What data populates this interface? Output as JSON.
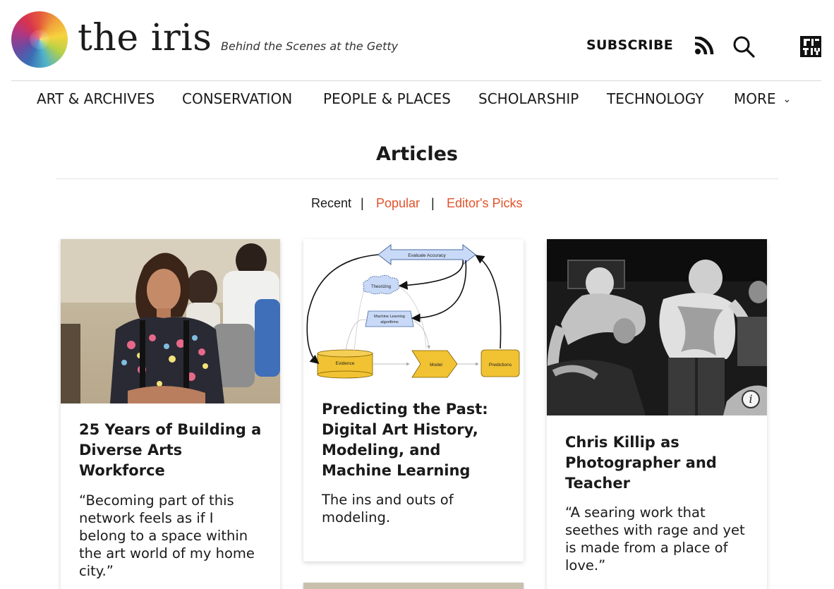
{
  "header": {
    "brand": "the iris",
    "tagline": "Behind the Scenes at the Getty",
    "subscribe_label": "SUBSCRIBE",
    "icons": [
      "rss-icon",
      "search-icon",
      "getty-logo"
    ]
  },
  "nav": {
    "items": [
      {
        "label": "ART & ARCHIVES"
      },
      {
        "label": "CONSERVATION"
      },
      {
        "label": "PEOPLE & PLACES"
      },
      {
        "label": "SCHOLARSHIP"
      },
      {
        "label": "TECHNOLOGY"
      },
      {
        "label": "MORE"
      }
    ]
  },
  "section": {
    "title": "Articles"
  },
  "tabs": {
    "items": [
      {
        "label": "Recent",
        "active": true
      },
      {
        "label": "Popular",
        "active": false
      },
      {
        "label": "Editor's Picks",
        "active": false
      }
    ],
    "separator": "|"
  },
  "colors": {
    "accent_link": "#e2532b",
    "text": "#1a1a1a",
    "diagram_box": "#f1c232",
    "diagram_blue": "#c9daf8"
  },
  "cards": [
    {
      "title": "25 Years of Building a Diverse Arts Workforce",
      "description": "“Becoming part of this network feels as if I belong to a space within the art world of my home city.”",
      "image": "photo-young-woman-seated-group"
    },
    {
      "title": "Predicting the Past: Digital Art History, Modeling, and Machine Learning",
      "description": "The ins and outs of modeling.",
      "image": "diagram-machine-learning-cycle",
      "diagram": {
        "evaluate": "Evaluate Accuracy",
        "theorizing": "Theorizing",
        "ml": "Machine Learning algorithms",
        "evidence": "Evidence",
        "model": "Model",
        "predictions": "Predictions"
      }
    },
    {
      "title": "Chris Killip as Photographer and Teacher",
      "description": "“A searing work that seethes with rage and yet is made from a place of love.”",
      "image": "bw-photo-concert-crowd",
      "info_icon": "i"
    }
  ]
}
